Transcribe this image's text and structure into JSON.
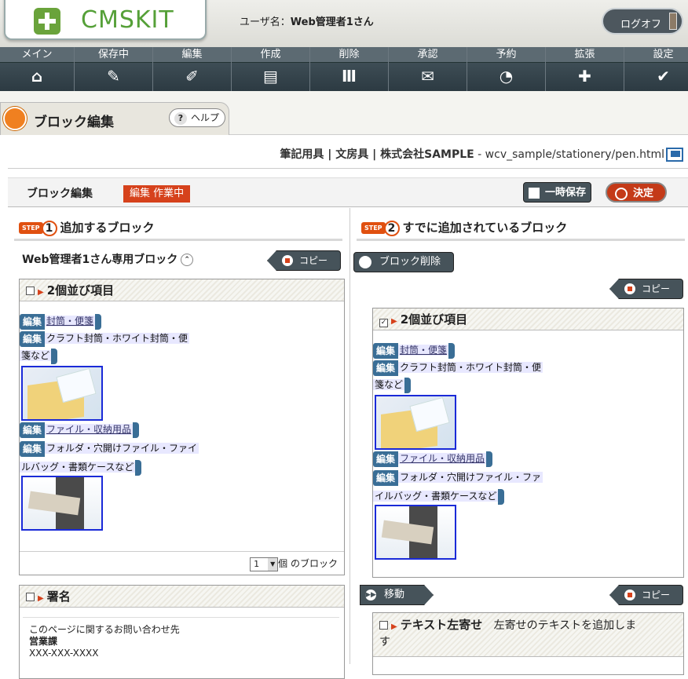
{
  "header": {
    "logo_text": "CMSKIT",
    "user_label": "ユーザ名：",
    "user_name": "Web管理者1さん",
    "logoff_label": "ログオフ"
  },
  "nav": [
    {
      "label": "メイン",
      "icon": "home-icon",
      "glyph": "⌂"
    },
    {
      "label": "保存中",
      "icon": "draft-icon",
      "glyph": "✎"
    },
    {
      "label": "編集",
      "icon": "pen-icon",
      "glyph": "✐"
    },
    {
      "label": "作成",
      "icon": "document-icon",
      "glyph": "▤"
    },
    {
      "label": "削除",
      "icon": "trash-icon",
      "glyph": "Ⅲ"
    },
    {
      "label": "承認",
      "icon": "approve-icon",
      "glyph": "✉"
    },
    {
      "label": "予約",
      "icon": "clock-icon",
      "glyph": "◔"
    },
    {
      "label": "拡張",
      "icon": "plus-icon",
      "glyph": "✚"
    },
    {
      "label": "設定",
      "icon": "wrench-icon",
      "glyph": "✔"
    }
  ],
  "tab": {
    "title": "ブロック編集",
    "help_label": "ヘルプ",
    "help_glyph": "?"
  },
  "breadcrumb": {
    "text": "筆記用具 | 文房具 | 株式会社SAMPLE",
    "sep": " - ",
    "url": "wcv_sample/stationery/pen.html"
  },
  "editbar": {
    "title": "ブロック編集",
    "status": "編集 作業中",
    "temp_save": "一時保存",
    "decide": "決定"
  },
  "step1": {
    "tag": "STEP",
    "num": "1",
    "title": "追加するブロック",
    "subtitle": "Web管理者1さん専用ブロック",
    "copy": "コピー",
    "block1": {
      "title": "2個並び項目",
      "edit": "編集",
      "item1_link": "封筒・便箋",
      "item1_desc_a": "クラフト封筒・ホワイト封筒・便",
      "item1_desc_b": "箋など",
      "item2_link": "ファイル・収納用品",
      "item2_desc_a": "フォルダ・穴開けファイル・ファイ",
      "item2_desc_b": "ルバッグ・書類ケースなど"
    },
    "count_value": "1",
    "count_label": "個 のブロック",
    "block2": {
      "title": "署名",
      "line1": "このページに関するお問い合わせ先",
      "line2": "営業課",
      "line3": "XXX-XXX-XXXX"
    }
  },
  "step2": {
    "tag": "STEP",
    "num": "2",
    "title": "すでに追加されているブロック",
    "delete": "ブロック削除",
    "copy": "コピー",
    "move": "移動",
    "block1": {
      "title": "2個並び項目",
      "checked": "✓",
      "edit": "編集",
      "item1_link": "封筒・便箋",
      "item1_desc_a": "クラフト封筒・ホワイト封筒・便",
      "item1_desc_b": "箋など",
      "item2_link": "ファイル・収納用品",
      "item2_desc_a": "フォルダ・穴開けファイル・ファ",
      "item2_desc_b": "イルバッグ・書類ケースなど"
    },
    "block2": {
      "title": "テキスト左寄せ",
      "desc_a": "左寄せのテキストを追加しま",
      "desc_b": "す"
    }
  },
  "colors": {
    "accent": "#d6421c",
    "nav_bg": "#3c4a52",
    "logo_green": "#55a038",
    "edit_tag": "#3a6e96"
  }
}
